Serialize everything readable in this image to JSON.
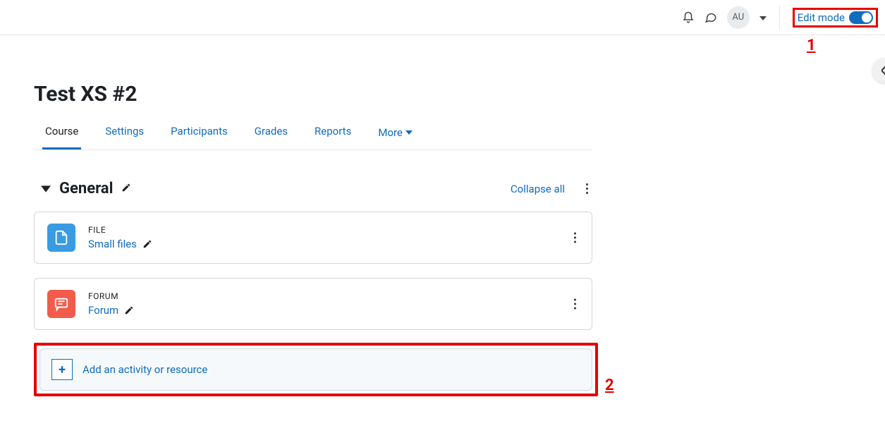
{
  "header": {
    "user_initials": "AU",
    "edit_mode_label": "Edit mode"
  },
  "annotations": {
    "one": "1",
    "two": "2"
  },
  "course": {
    "title": "Test XS #2"
  },
  "tabs": [
    {
      "label": "Course",
      "active": true
    },
    {
      "label": "Settings",
      "active": false
    },
    {
      "label": "Participants",
      "active": false
    },
    {
      "label": "Grades",
      "active": false
    },
    {
      "label": "Reports",
      "active": false
    },
    {
      "label": "More",
      "active": false,
      "dropdown": true
    }
  ],
  "section": {
    "title": "General",
    "collapse_label": "Collapse all"
  },
  "activities": [
    {
      "type_label": "FILE",
      "name": "Small files",
      "icon": "file"
    },
    {
      "type_label": "FORUM",
      "name": "Forum",
      "icon": "forum"
    }
  ],
  "add_activity": {
    "label": "Add an activity or resource"
  }
}
